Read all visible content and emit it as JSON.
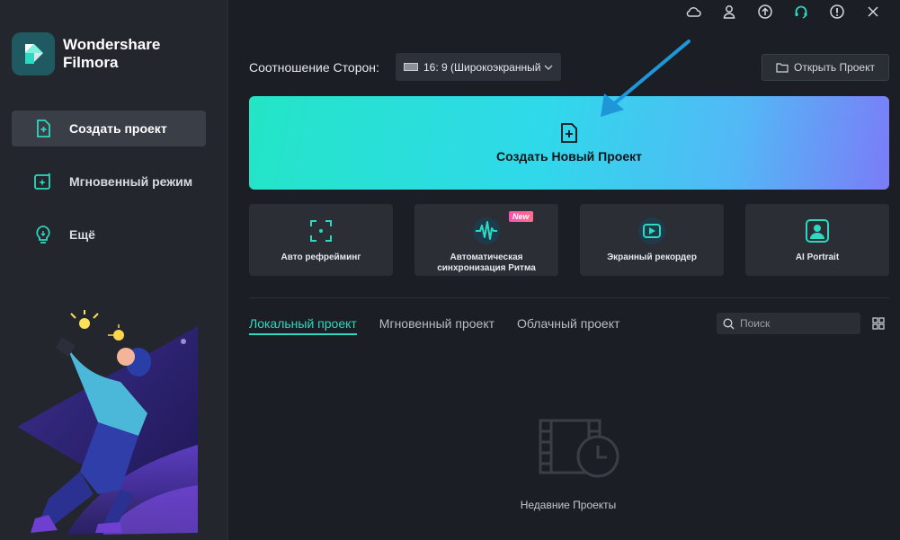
{
  "app": {
    "brand_line1": "Wondershare",
    "brand_line2": "Filmora"
  },
  "sidebar": {
    "items": [
      {
        "label": "Создать проект",
        "icon": "new-project-icon",
        "active": true
      },
      {
        "label": "Мгновенный режим",
        "icon": "instant-mode-icon",
        "active": false
      },
      {
        "label": "Ещё",
        "icon": "lightbulb-icon",
        "active": false
      }
    ]
  },
  "titlebar": {
    "icons": [
      "cloud-icon",
      "user-icon",
      "upload-icon",
      "headset-icon",
      "info-icon",
      "close-icon"
    ]
  },
  "toolbar": {
    "aspect_label": "Соотношение Сторон:",
    "aspect_value": "16: 9 (Широкоэкранный",
    "open_project_label": "Открыть Проект"
  },
  "create": {
    "label": "Создать Новый Проект"
  },
  "tools": [
    {
      "label": "Авто рефрейминг",
      "icon": "auto-reframe-icon"
    },
    {
      "label": "Автоматическая синхронизация Ритма",
      "icon": "beat-sync-icon",
      "badge": "New"
    },
    {
      "label": "Экранный рекордер",
      "icon": "screen-recorder-icon"
    },
    {
      "label": "AI Portrait",
      "icon": "ai-portrait-icon"
    }
  ],
  "tabs": [
    {
      "label": "Локальный проект",
      "active": true
    },
    {
      "label": "Мгновенный проект",
      "active": false
    },
    {
      "label": "Облачный проект",
      "active": false
    }
  ],
  "search": {
    "placeholder": "Поиск"
  },
  "empty_state": {
    "label": "Недавние Проекты"
  },
  "colors": {
    "accent": "#2fd8c0",
    "banner_start": "#23e5c6",
    "banner_end": "#7b7cf7",
    "arrow": "#1e96d8"
  }
}
